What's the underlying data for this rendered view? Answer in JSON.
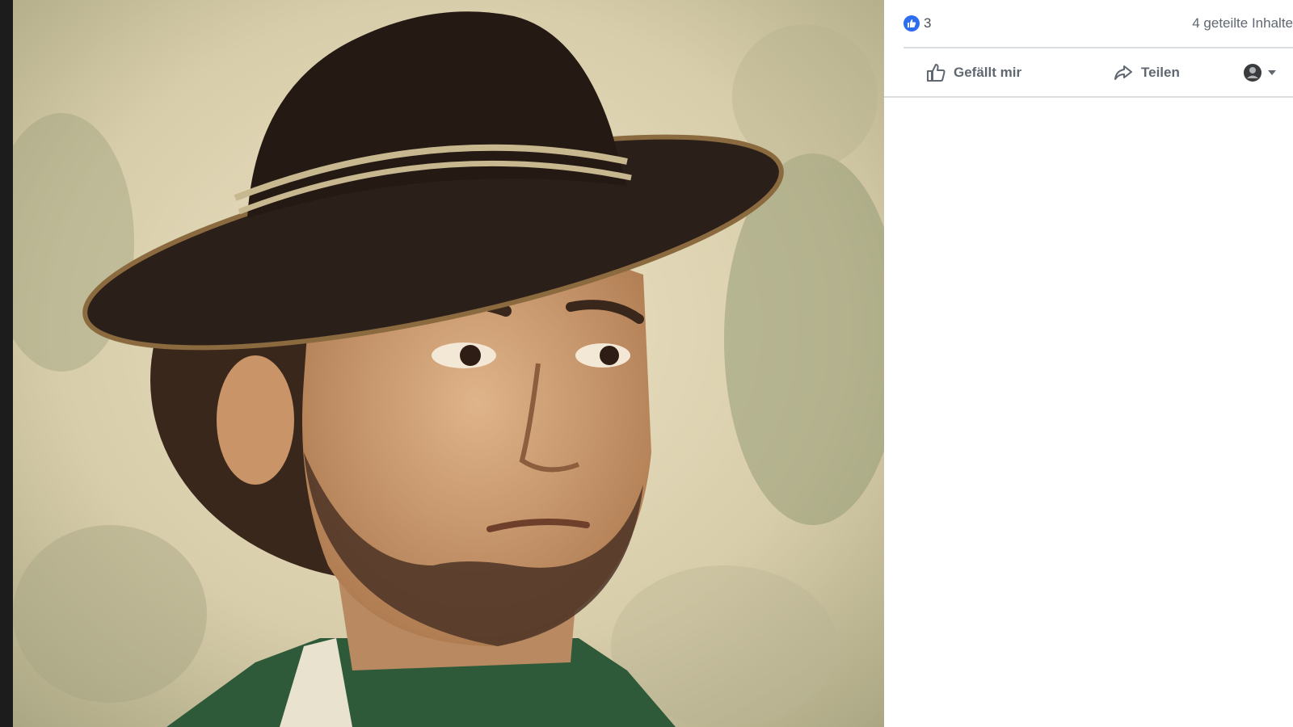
{
  "photo": {
    "description_icon": "portrait-photo",
    "colors": {
      "background": "#d9cfb1",
      "hat": "#2b1f1a",
      "skin": "#c79a6e",
      "jacket": "#2f5a3a"
    }
  },
  "reactions": {
    "icon": "like-icon",
    "count": "3",
    "badge_color": "#2d6df0"
  },
  "shares": {
    "label": "4 geteilte Inhalte"
  },
  "actions": {
    "like_label": "Gefällt mir",
    "share_label": "Teilen",
    "like_icon": "thumbs-up-icon",
    "share_icon": "share-arrow-icon",
    "audience_icon": "avatar-icon",
    "audience_dropdown_icon": "caret-down-icon"
  }
}
